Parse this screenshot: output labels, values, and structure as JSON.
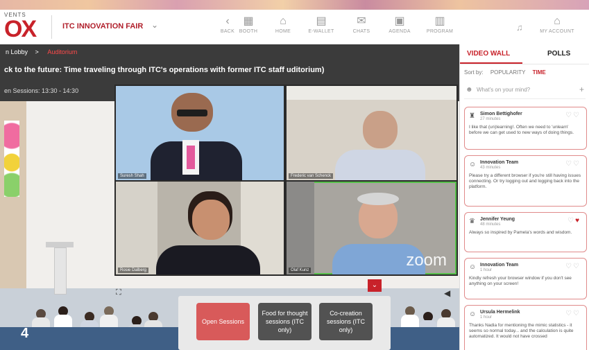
{
  "header": {
    "logo_sub": "VENTS",
    "logo_main": "OX",
    "event_title": "ITC INNOVATION FAIR",
    "nav": [
      {
        "icon": "back-icon",
        "glyph": "‹",
        "label": "BACK"
      },
      {
        "icon": "booth-icon",
        "glyph": "▦",
        "label": "BOOTH"
      },
      {
        "icon": "home-icon",
        "glyph": "⌂",
        "label": "HOME"
      },
      {
        "icon": "wallet-icon",
        "glyph": "▤",
        "label": "E-WALLET"
      },
      {
        "icon": "chat-icon",
        "glyph": "✉",
        "label": "CHATS"
      },
      {
        "icon": "agenda-icon",
        "glyph": "▣",
        "label": "AGENDA"
      },
      {
        "icon": "program-icon",
        "glyph": "▥",
        "label": "PROGRAM"
      }
    ],
    "account_label": "MY ACCOUNT"
  },
  "stage": {
    "breadcrumb_root": "n Lobby",
    "breadcrumb_sep": ">",
    "breadcrumb_current": "Auditorium",
    "title": "ck to the future: Time traveling through ITC's operations with former ITC staff uditorium)",
    "subtitle": "en Sessions: 13:30 - 14:30",
    "zoom_watermark": "zoom",
    "participants": [
      "Suresh Shah",
      "Frederic van Schenck",
      "Rosie Dalberg",
      "Olaf Kunz"
    ]
  },
  "sessions": {
    "buttons": [
      "Open Sessions",
      "Food for thought sessions (ITC only)",
      "Co-creation sessions (ITC only)"
    ]
  },
  "badge_number": "4",
  "panel": {
    "tabs": [
      "VIDEO WALL",
      "POLLS"
    ],
    "sort_label": "Sort by:",
    "sort_options": [
      "POPULARITY",
      "TIME"
    ],
    "compose_placeholder": "What's on your mind?",
    "posts": [
      {
        "author": "Simon Bettighofer",
        "time": "27 minutes",
        "text": "I like that (un)learning!. Often we need to 'unlearn' before we can get used to new ways of doing things."
      },
      {
        "author": "Innovation Team",
        "time": "43 minutes",
        "text": "Please try a different browser if you're still having issues connecting. Or try logging out and logging back into the platform."
      },
      {
        "author": "Jennifer Yeung",
        "time": "48 minutes",
        "text": "Always so inspired by Pamela's words and wisdom."
      },
      {
        "author": "Innovation Team",
        "time": "1 hour",
        "text": "Kindly refresh your browser window if you don't see anything on your screen!"
      },
      {
        "author": "Ursula Hermelink",
        "time": "1 hour",
        "text": "Thanks Nadia for mentioning the mimic statistics - it seems so normal today... and the calculation is quite automatized. It would not have crossed"
      }
    ]
  },
  "colors": {
    "accent": "#c8222a",
    "active_tile": "#56c04a",
    "session_active": "#d85a5a",
    "session_idle": "#525252"
  }
}
